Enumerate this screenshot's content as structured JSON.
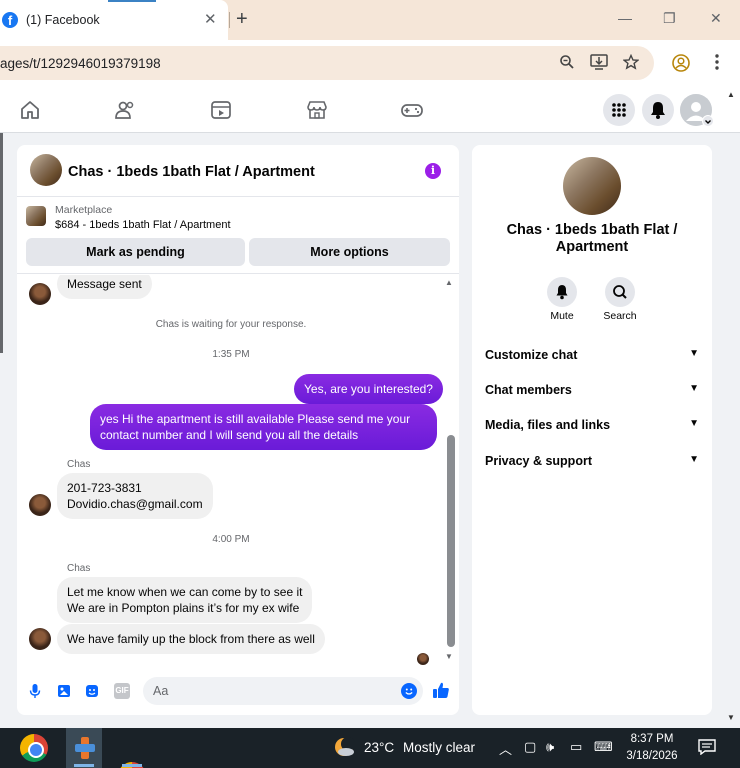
{
  "browser": {
    "tab_title": "(1) Facebook",
    "tab_close": "✕",
    "new_tab": "+",
    "url": "ages/t/1292946019379198",
    "window_controls": [
      "—",
      "❐",
      "✕"
    ]
  },
  "fbnav": {
    "icons": [
      "home-icon",
      "friends-icon",
      "video-icon",
      "marketplace-icon",
      "gaming-icon"
    ],
    "right_icons": [
      "menu-grid-icon",
      "notifications-icon",
      "account-icon"
    ]
  },
  "chat": {
    "title": "Chas · 1beds 1bath Flat / Apartment",
    "info_icon": "i",
    "marketplace": {
      "label": "Marketplace",
      "price_line": "$684 - 1beds 1bath Flat / Apartment",
      "btn_pending": "Mark as pending",
      "btn_more": "More options"
    },
    "messages": {
      "msg_sent": "Message sent",
      "waiting": "Chas is waiting for your response.",
      "time1": "1:35 PM",
      "out1": "Yes, are you interested?",
      "out2": "yes Hi the apartment is still available Please send me your\ncontact number and I will send you all the details",
      "sender1": "Chas",
      "in1": "201-723-3831\nDovidio.chas@gmail.com",
      "time2": "4:00 PM",
      "sender2": "Chas",
      "in2": "Let me know when we can come by to see it\nWe are in Pompton plains it’s for my ex wife",
      "in3": "We have family up the block from there as well"
    },
    "composer": {
      "placeholder": "Aa",
      "gif": "GIF"
    }
  },
  "info_panel": {
    "title": "Chas · 1beds 1bath Flat / Apartment",
    "mute": "Mute",
    "search": "Search",
    "sections": [
      "Customize chat",
      "Chat members",
      "Media, files and links",
      "Privacy & support"
    ]
  },
  "taskbar": {
    "temperature": "23°C",
    "weather": "Mostly clear",
    "time": "8:37 PM",
    "date": "3/18/2026"
  },
  "colors": {
    "accent": "#7b1fe8",
    "facebook_blue": "#1877f2"
  }
}
